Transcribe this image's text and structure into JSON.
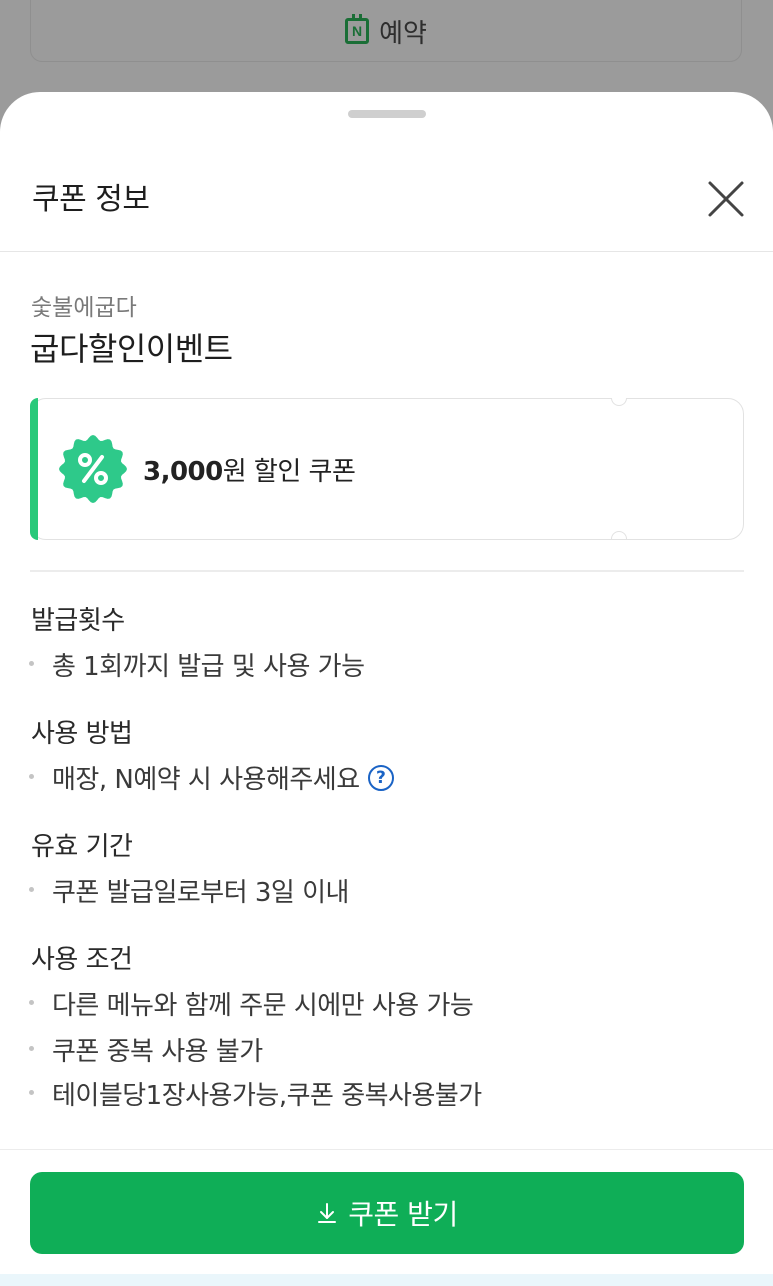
{
  "background": {
    "reserve_button_label": "예약",
    "reserve_icon": "naver-reservation-calendar-icon"
  },
  "sheet": {
    "title": "쿠폰 정보",
    "close_icon": "close-icon"
  },
  "store": {
    "name": "숯불에굽다",
    "event": "굽다할인이벤트"
  },
  "coupon": {
    "amount": "3,000",
    "suffix": "원 할인 쿠폰",
    "badge_icon": "percent-badge-icon",
    "accent_color": "#29c97a"
  },
  "info": {
    "issue_count": {
      "label": "발급횟수",
      "items": [
        "총 1회까지 발급 및 사용 가능"
      ]
    },
    "usage_method": {
      "label": "사용 방법",
      "items": [
        "매장, N예약 시 사용해주세요"
      ],
      "help_icon": "question-circle-icon"
    },
    "validity": {
      "label": "유효 기간",
      "items": [
        "쿠폰 발급일로부터 3일 이내"
      ]
    },
    "conditions": {
      "label": "사용 조건",
      "items": [
        "다른 메뉴와 함께 주문 시에만 사용 가능",
        "쿠폰 중복 사용 불가",
        "테이블당1장사용가능,쿠폰 중복사용불가"
      ]
    }
  },
  "footer": {
    "download_label": "쿠폰 받기",
    "download_icon": "download-arrow-icon",
    "button_color": "#0fae57"
  }
}
